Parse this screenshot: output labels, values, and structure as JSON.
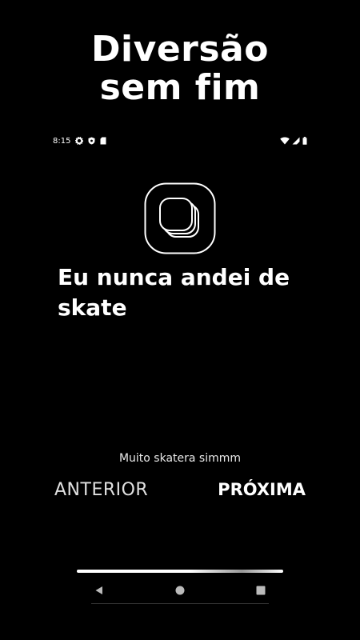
{
  "promo": {
    "title_line1": "Diversão",
    "title_line2": "sem fim"
  },
  "status_bar": {
    "time": "8:15",
    "left_icons": [
      "settings-icon",
      "shield-icon",
      "sim-card-icon"
    ],
    "right_icons": [
      "wifi-icon",
      "cell-signal-icon",
      "battery-icon"
    ]
  },
  "card": {
    "icon": "stacked-cards-icon",
    "question": "Eu nunca andei de skate",
    "answer": "Muito skatera simmm"
  },
  "buttons": {
    "previous": "ANTERIOR",
    "next": "PRÓXIMA"
  },
  "progress": {
    "value": 1.0
  },
  "nav_bar": {
    "icons": [
      "back-icon",
      "home-icon",
      "recents-icon"
    ]
  }
}
